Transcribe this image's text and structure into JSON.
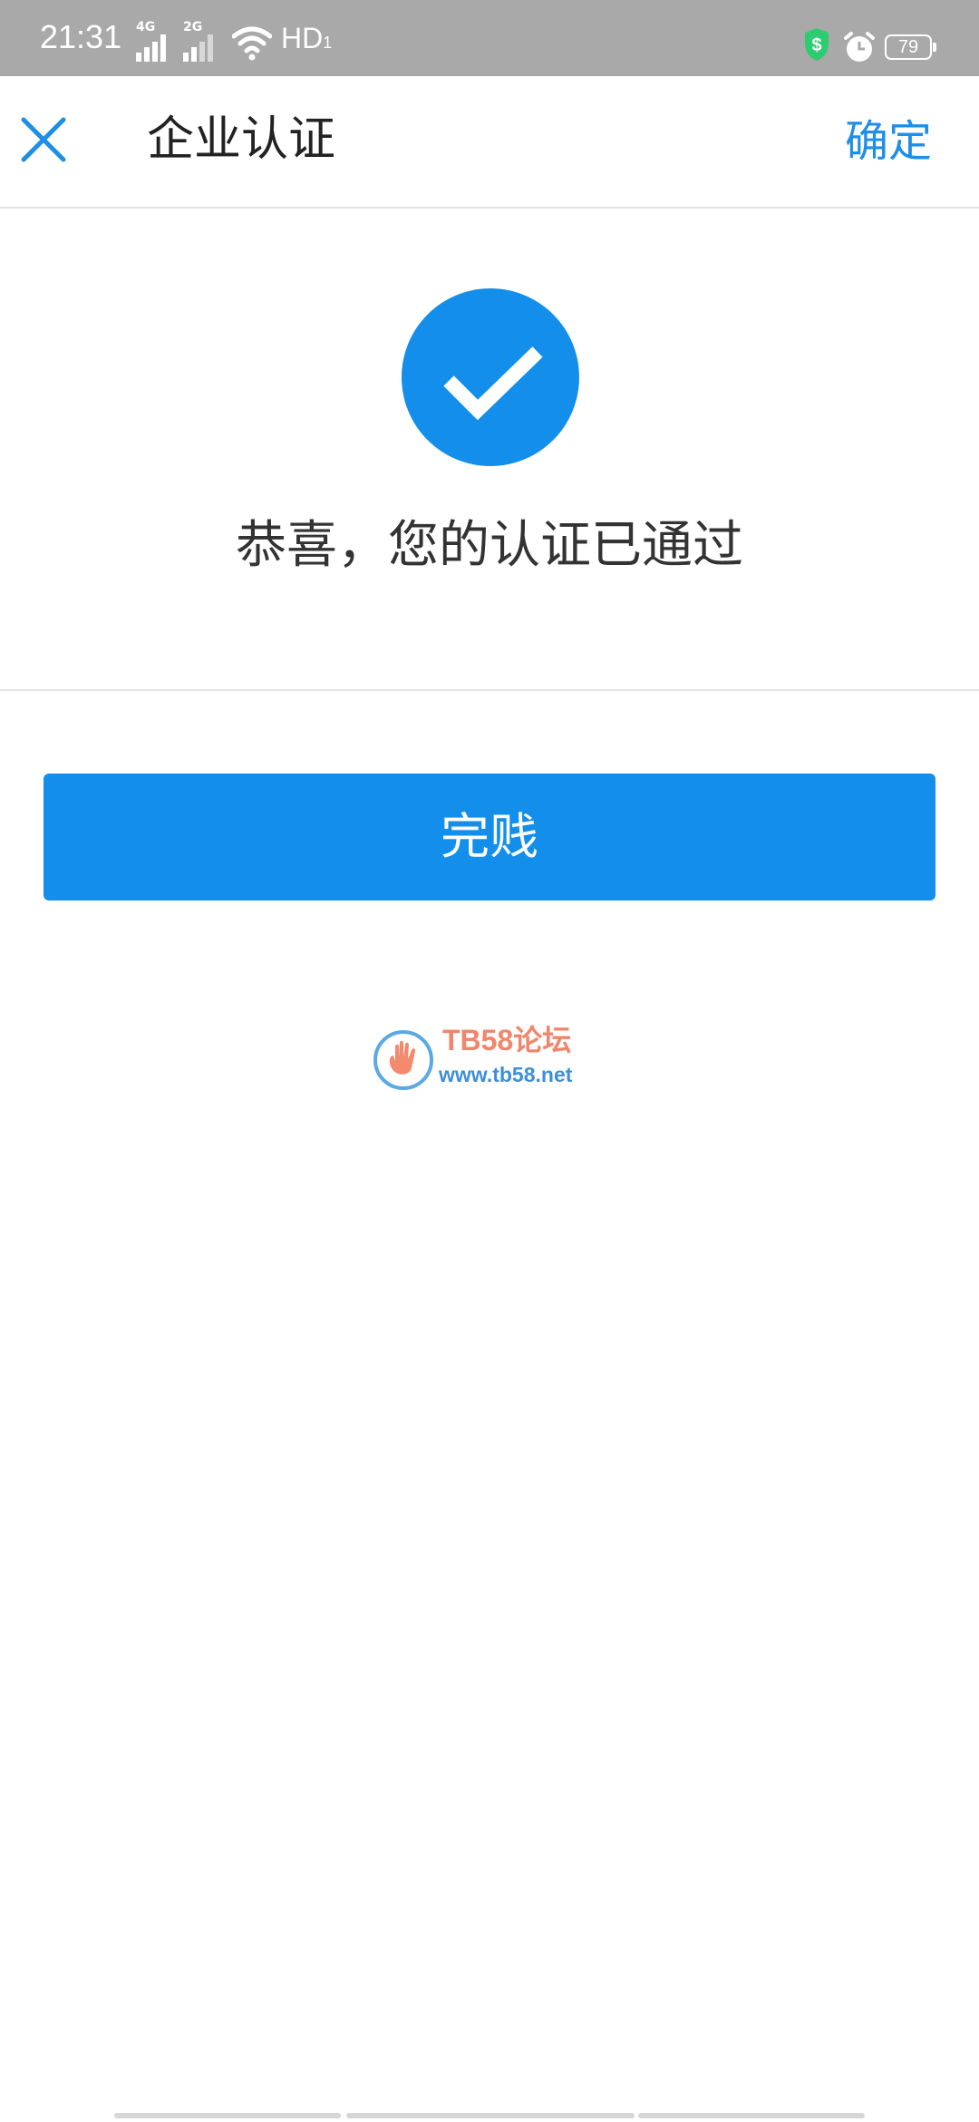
{
  "status_bar": {
    "time": "21:31",
    "network_1": "4G",
    "network_2": "2G",
    "hd": "HD",
    "hd_sub": "1",
    "battery": "79",
    "shield_icon": "shield-dollar-icon",
    "alarm_icon": "alarm-clock-icon",
    "wifi_icon": "wifi-icon"
  },
  "header": {
    "title": "企业认证",
    "confirm_label": "确定",
    "close_icon": "close-icon",
    "accent_color": "#1e8ee6"
  },
  "success": {
    "icon": "check-circle-icon",
    "message": "恭喜，您的认证已通过",
    "circle_color": "#138feb"
  },
  "done_button": {
    "label": "完贱",
    "color": "#138feb"
  },
  "watermark": {
    "title": "TB58论坛",
    "url": "www.tb58.net"
  }
}
